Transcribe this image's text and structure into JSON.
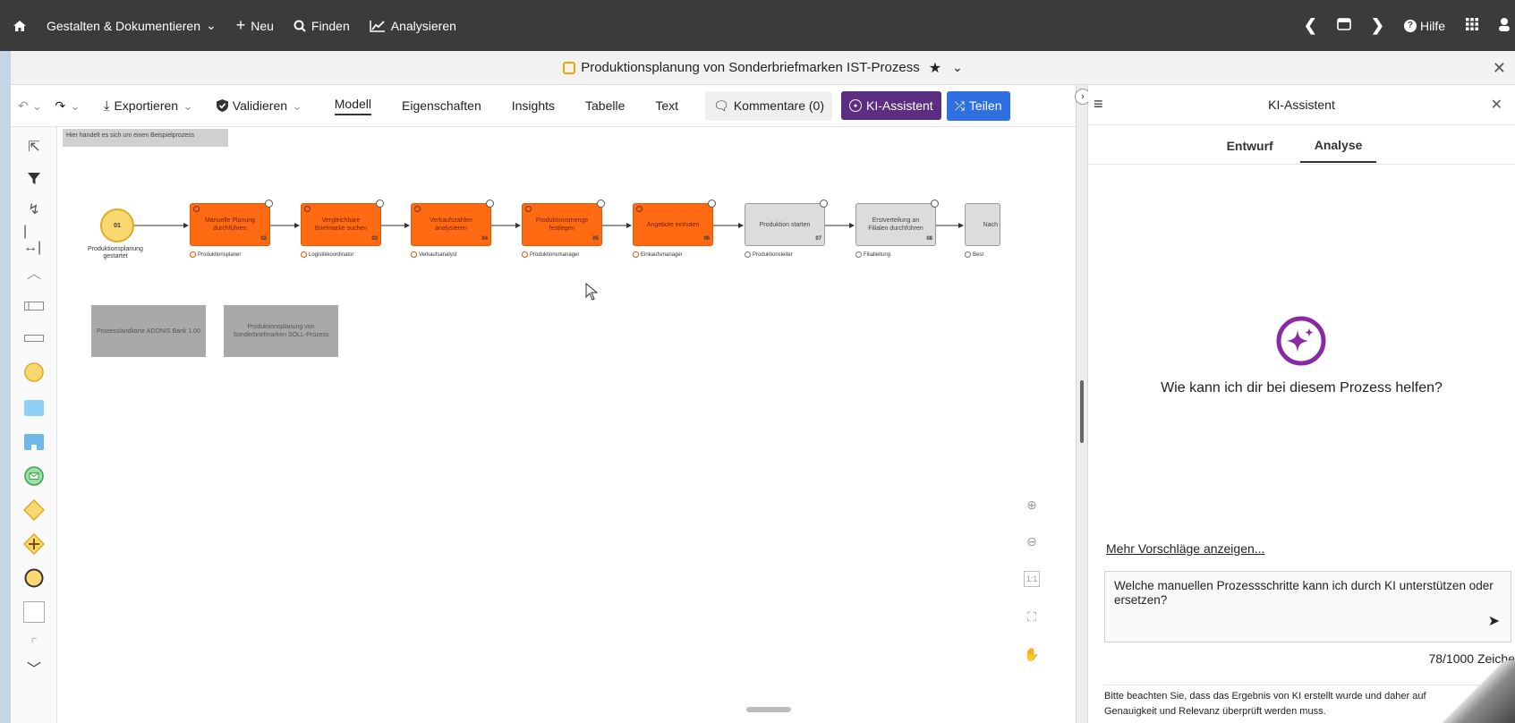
{
  "topbar": {
    "design_menu": "Gestalten & Dokumentieren",
    "new_label": "Neu",
    "find_label": "Finden",
    "analyze_label": "Analysieren",
    "help_label": "Hilfe"
  },
  "title": {
    "document_name": "Produktionsplanung von Sonderbriefmarken IST-Prozess"
  },
  "toolbar": {
    "export_label": "Exportieren",
    "validate_label": "Validieren",
    "tabs": [
      "Modell",
      "Eigenschaften",
      "Insights",
      "Tabelle",
      "Text"
    ],
    "comments_label": "Kommentare (0)",
    "ki_label": "KI-Assistent",
    "share_label": "Teilen"
  },
  "canvas": {
    "note": "Hier handelt es sich um einen Beispielprozess",
    "start": {
      "number": "01",
      "label": "Produktionsplanung gestartet"
    },
    "tasks": [
      {
        "label": "Manuelle Planung durchführen",
        "number": "02",
        "role": "Produktionsplaner",
        "style": "orange"
      },
      {
        "label": "Vergleichbare Briefmarke suchen",
        "number": "03",
        "role": "Logistikkoordinator",
        "style": "orange"
      },
      {
        "label": "Verkaufszahlen analysieren",
        "number": "04",
        "role": "Verkaufsanalyst",
        "style": "orange"
      },
      {
        "label": "Produktionsmenge festlegen",
        "number": "05",
        "role": "Produktionsmanager",
        "style": "orange"
      },
      {
        "label": "Angebote einholen",
        "number": "06",
        "role": "Einkaufsmanager",
        "style": "orange"
      },
      {
        "label": "Produktion starten",
        "number": "07",
        "role": "Produktionsleiter",
        "style": "grey"
      },
      {
        "label": "Erstverteilung an Filialen durchführen",
        "number": "08",
        "role": "Filialleitung",
        "style": "grey"
      },
      {
        "label": "Nach",
        "number": "",
        "role": "Best",
        "style": "grey"
      }
    ],
    "linked_processes": [
      "Prozesslandkarte ADONIS Bank 1.00",
      "Produktionsplanung von Sonderbriefmarken SOLL-Prozess"
    ]
  },
  "ki_panel": {
    "header_title": "KI-Assistent",
    "tabs": [
      "Entwurf",
      "Analyse"
    ],
    "active_tab": "Analyse",
    "question": "Wie kann ich dir bei diesem Prozess helfen?",
    "more_suggestions": "Mehr Vorschläge anzeigen...",
    "input_text": "Welche manuellen Prozessschritte kann ich durch KI unterstützen oder ersetzen?",
    "char_counter": "78/1000 Zeiche",
    "disclaimer": "Bitte beachten Sie, dass das Ergebnis von KI erstellt wurde und daher auf Genauigkeit und Relevanz überprüft werden muss."
  },
  "colors": {
    "topbar": "#3b3b3b",
    "ki_button": "#5c2d82",
    "share_button": "#2f6fe0",
    "task_orange": "#ff6a13",
    "task_grey": "#dcdcdc",
    "start_event": "#f9d870",
    "sparkle": "#8a2aa3"
  },
  "icons": {
    "home": "home-icon",
    "plus": "plus-icon",
    "search": "search-icon",
    "chart": "chart-icon",
    "help": "help-icon",
    "grid": "grid-icon",
    "sparkle": "sparkle-icon",
    "send": "send-icon"
  }
}
